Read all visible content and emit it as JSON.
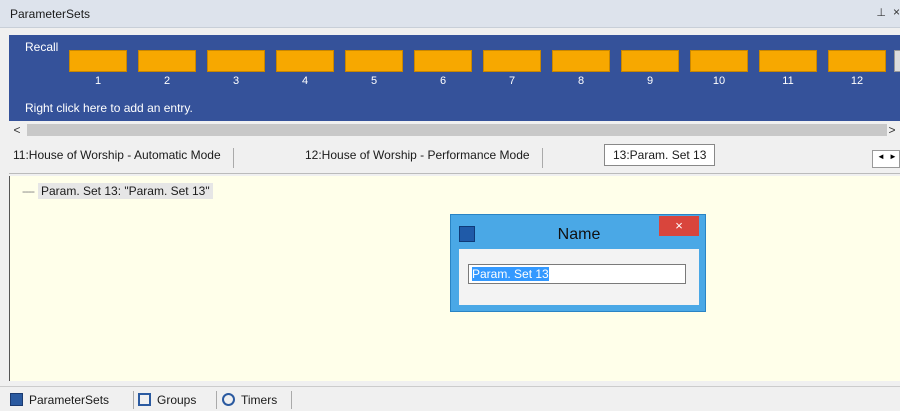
{
  "window": {
    "title": "ParameterSets",
    "pin_glyph": "⊥",
    "close_glyph": "×"
  },
  "recall": {
    "label": "Recall",
    "slots": [
      "1",
      "2",
      "3",
      "4",
      "5",
      "6",
      "7",
      "8",
      "9",
      "10",
      "11",
      "12"
    ],
    "hint": "Right click here to add an entry.",
    "slot_color": "#f7a800",
    "panel_color": "#35529a"
  },
  "scroll": {
    "left": "<",
    "right": ">"
  },
  "tabs": [
    {
      "label": "11:House of Worship - Automatic Mode"
    },
    {
      "label": "12:House of Worship - Performance Mode"
    },
    {
      "label": "13:Param. Set 13"
    }
  ],
  "tabnav": {
    "prev": "◄",
    "next": "►"
  },
  "tree": {
    "connector": "----",
    "node_label": "Param. Set 13: \"Param. Set 13\""
  },
  "dialog": {
    "title": "Name",
    "close": "×",
    "input_value": "Param. Set 13"
  },
  "bottom_tabs": [
    {
      "label": "ParameterSets",
      "icon": "parameter-sets-icon"
    },
    {
      "label": "Groups",
      "icon": "groups-icon"
    },
    {
      "label": "Timers",
      "icon": "timers-icon"
    }
  ]
}
